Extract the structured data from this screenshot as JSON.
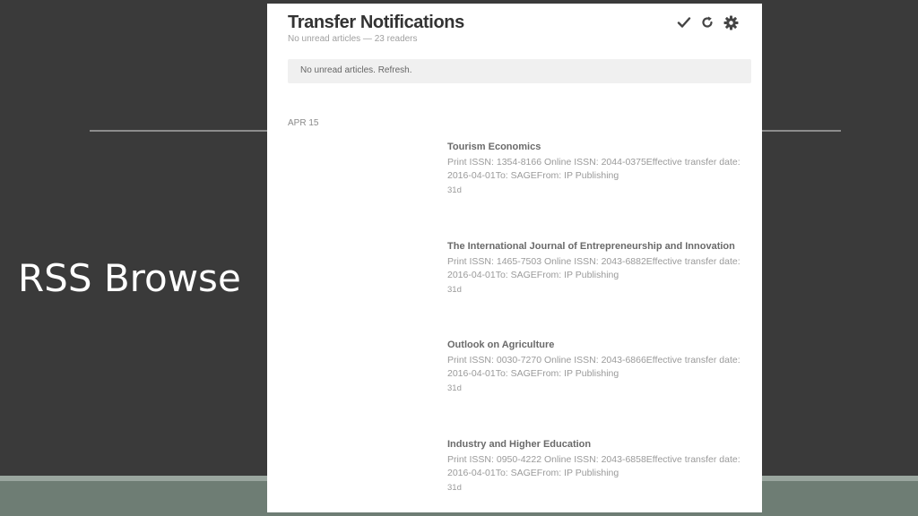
{
  "slide": {
    "title": "RSS Browse"
  },
  "feed": {
    "title": "Transfer Notifications",
    "subtitle": "No unread articles — 23 readers",
    "notice": "No unread articles. Refresh.",
    "toolbar": {
      "icons": [
        "check-icon",
        "refresh-icon",
        "gear-icon"
      ]
    },
    "date_group": "APR 15",
    "articles": [
      {
        "title": "Tourism Economics",
        "desc_line1": "Print ISSN: 1354-8166 Online ISSN: 2044-0375Effective transfer date:",
        "desc_line2": "2016-04-01To: SAGEFrom: IP Publishing",
        "age": "31d"
      },
      {
        "title": "The International Journal of Entrepreneurship and Innovation",
        "desc_line1": "Print ISSN: 1465-7503 Online ISSN: 2043-6882Effective transfer date:",
        "desc_line2": "2016-04-01To: SAGEFrom: IP Publishing",
        "age": "31d"
      },
      {
        "title": "Outlook on Agriculture",
        "desc_line1": "Print ISSN: 0030-7270 Online ISSN: 2043-6866Effective transfer date:",
        "desc_line2": "2016-04-01To: SAGEFrom: IP Publishing",
        "age": "31d"
      },
      {
        "title": "Industry and Higher Education",
        "desc_line1": "Print ISSN: 0950-4222 Online ISSN: 2043-6858Effective transfer date:",
        "desc_line2": "2016-04-01To: SAGEFrom: IP Publishing",
        "age": "31d"
      }
    ]
  },
  "colors": {
    "slide_background": "#3a3a3a",
    "footer_band": "#6e7d74",
    "panel_background": "#ffffff",
    "notice_background": "#f0f0f0"
  }
}
